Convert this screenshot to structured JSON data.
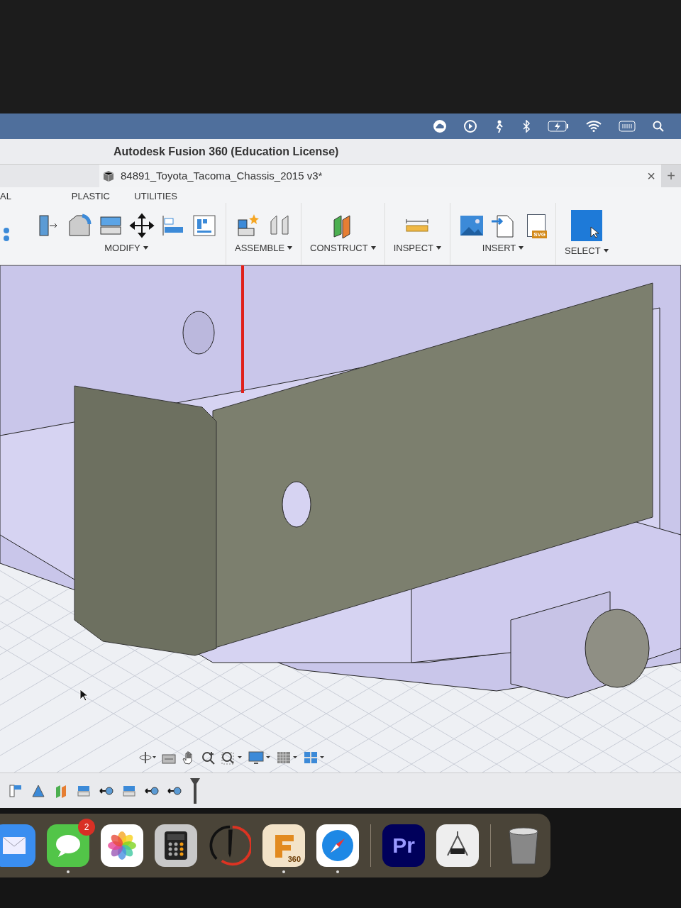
{
  "window": {
    "title": "Autodesk Fusion 360 (Education License)"
  },
  "document_tab": {
    "name": "84891_Toyota_Tacoma_Chassis_2015 v3*",
    "close": "×",
    "new_tab": "+"
  },
  "workspace_tabs": [
    {
      "label": "AL",
      "selected": false
    },
    {
      "label": "PLASTIC",
      "selected": false
    },
    {
      "label": "UTILITIES",
      "selected": false
    }
  ],
  "toolbar_groups": [
    {
      "label": "MODIFY"
    },
    {
      "label": "ASSEMBLE"
    },
    {
      "label": "CONSTRUCT"
    },
    {
      "label": "INSPECT"
    },
    {
      "label": "INSERT",
      "icon_text": "SVG"
    },
    {
      "label": "SELECT"
    }
  ],
  "dock": [
    {
      "kind": "mail",
      "running": false
    },
    {
      "kind": "messages",
      "badge": "2",
      "running": true
    },
    {
      "kind": "photos",
      "running": false
    },
    {
      "kind": "calculator",
      "running": false
    },
    {
      "kind": "drawing",
      "running": false
    },
    {
      "kind": "fusion",
      "icon_text": "360",
      "running": true
    },
    {
      "kind": "safari",
      "running": true
    },
    {
      "kind": "premiere",
      "icon_text": "Pr",
      "running": false
    },
    {
      "kind": "caliper",
      "running": false
    },
    {
      "kind": "trash",
      "running": false
    }
  ]
}
